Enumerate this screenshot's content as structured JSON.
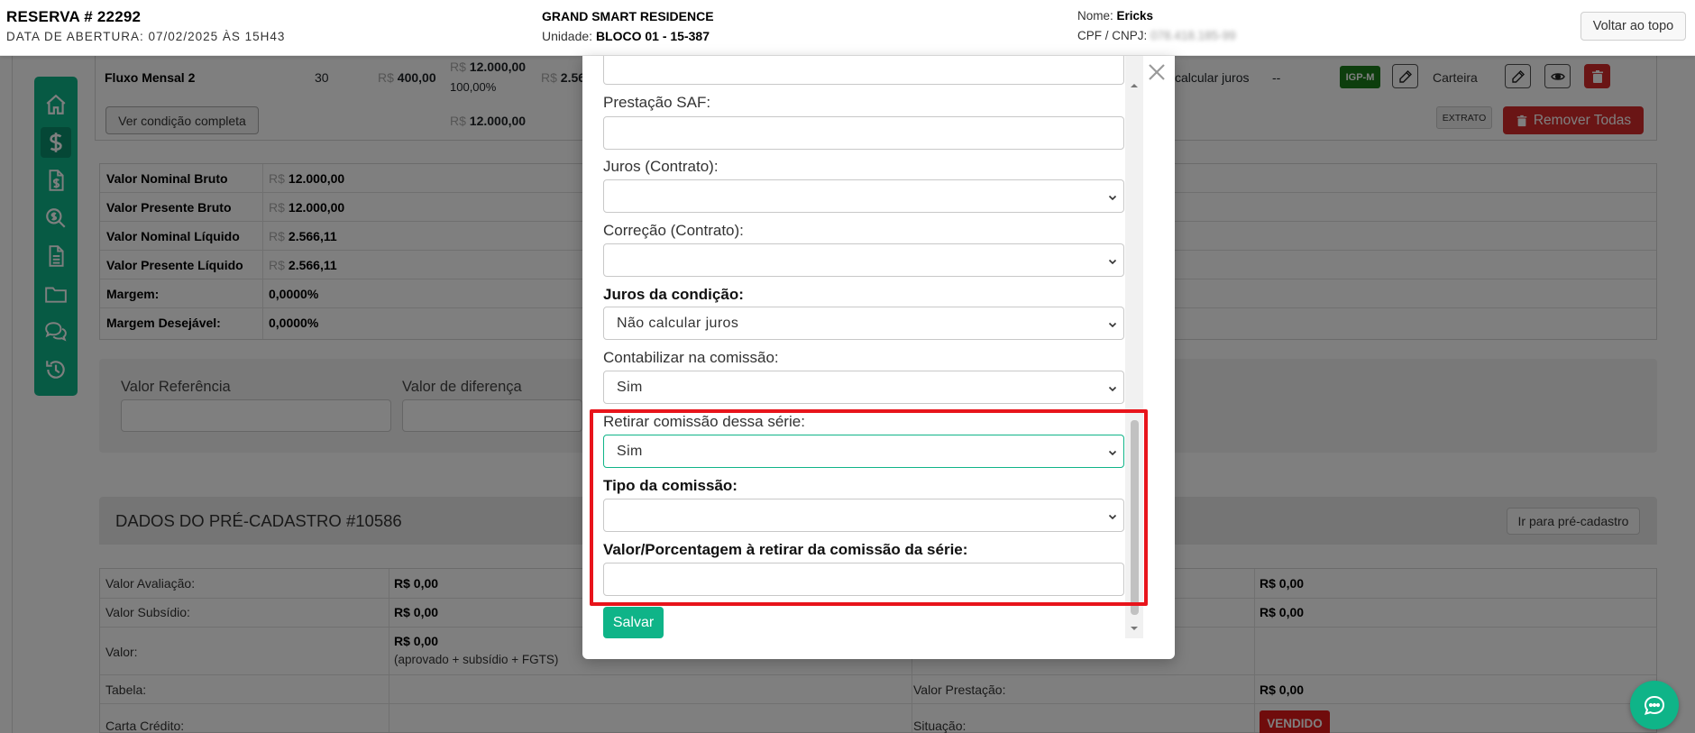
{
  "header": {
    "reserva_title": "RESERVA # 22292",
    "opening_date": "DATA DE ABERTURA: 07/02/2025 ÀS 15H43",
    "project_name": "GRAND SMART RESIDENCE",
    "unit_label": "Unidade:",
    "unit_value": "BLOCO 01 - 15-387",
    "name_label": "Nome:",
    "name_value": "Ericks",
    "cpf_label": "CPF / CNPJ:",
    "cpf_value": "078.418.185-99",
    "back_to_top_label": "Voltar ao topo"
  },
  "sidebar": {
    "items": [
      {
        "icon": "home-icon"
      },
      {
        "icon": "dollar-icon",
        "active": true
      },
      {
        "icon": "invoice-icon"
      },
      {
        "icon": "search-dollar-icon"
      },
      {
        "icon": "document-icon"
      },
      {
        "icon": "folder-icon"
      },
      {
        "icon": "comments-icon"
      },
      {
        "icon": "history-icon"
      }
    ]
  },
  "flow_row": {
    "name": "Fluxo Mensal 2",
    "quantity": "30",
    "currency": "R$",
    "installment": "400,00",
    "total": "12.000,00",
    "percent": "100,00%",
    "partial": "2.56",
    "interest": "calcular juros",
    "dash": "--",
    "index_badge": "IGP-M",
    "portfolio": "Carteira",
    "view_condition_label": "Ver condição completa",
    "sum_total": "12.000,00",
    "extrato_label": "EXTRATO",
    "remove_all_label": "Remover Todas"
  },
  "summary": {
    "rows": [
      {
        "label": "Valor Nominal Bruto",
        "currency": "R$",
        "value": "12.000,00"
      },
      {
        "label": "Valor Presente Bruto",
        "currency": "R$",
        "value": "12.000,00"
      },
      {
        "label": "Valor Nominal Líquido",
        "currency": "R$",
        "value": "2.566,11"
      },
      {
        "label": "Valor Presente Líquido",
        "currency": "R$",
        "value": "2.566,11"
      },
      {
        "label": "Margem:",
        "currency": "",
        "value": "0,0000%"
      },
      {
        "label": "Margem Desejável:",
        "currency": "",
        "value": "0,0000%"
      }
    ]
  },
  "reference": {
    "ref_label": "Valor Referência",
    "diff_label": "Valor de diferença"
  },
  "precadastro": {
    "title": "DADOS DO PRÉ-CADASTRO #10586",
    "goto_label": "Ir para pré-cadastro",
    "rows": [
      {
        "label": "Valor Avaliação:",
        "value": "R$ 0,00",
        "right_value": "R$ 0,00"
      },
      {
        "label": "Valor Subsídio:",
        "value": "R$ 0,00",
        "right_value": "R$ 0,00"
      },
      {
        "label": "Valor:",
        "value": "R$ 0,00",
        "note": "(aprovado + subsídio + FGTS)"
      },
      {
        "label": "Tabela:",
        "right_label": "Valor Prestação:",
        "right_value": "R$ 0,00"
      },
      {
        "label": "Carta Crédito:",
        "right_label": "Situação:",
        "status": "VENDIDO"
      }
    ]
  },
  "modal": {
    "fields": {
      "prestacao_saf_label": "Prestação SAF:",
      "juros_contrato_label": "Juros (Contrato):",
      "correcao_contrato_label": "Correção (Contrato):",
      "juros_condicao_label": "Juros da condição:",
      "juros_condicao_value": "Não calcular juros",
      "contabilizar_label": "Contabilizar na comissão:",
      "contabilizar_value": "Sim",
      "retirar_label": "Retirar comissão dessa série:",
      "retirar_value": "Sim",
      "tipo_label": "Tipo da comissão:",
      "valor_pct_label": "Valor/Porcentagem à retirar da comissão da série:"
    },
    "save_label": "Salvar"
  },
  "colors": {
    "brand": "#0fb488",
    "danger": "#d42a2a",
    "highlight": "#e8141b"
  }
}
